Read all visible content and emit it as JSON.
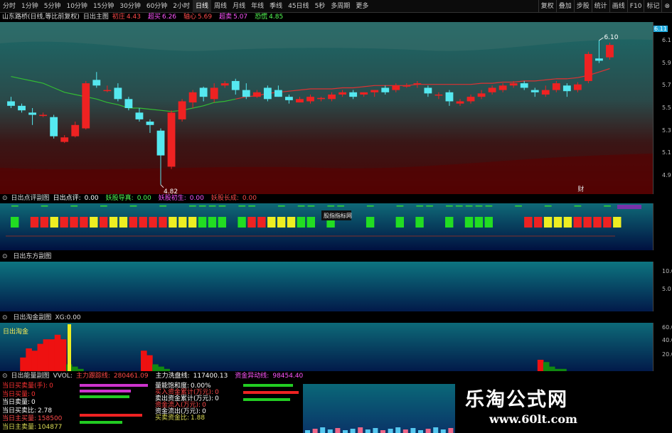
{
  "toolbar": {
    "items": [
      "分时",
      "1分钟",
      "5分钟",
      "10分钟",
      "15分钟",
      "30分钟",
      "60分钟",
      "2小时",
      "日线",
      "周线",
      "月线",
      "年线",
      "季线",
      "45日线",
      "5秒",
      "多周期",
      "更多"
    ],
    "active": "日线",
    "right": [
      "复权",
      "叠加",
      "步股",
      "统计",
      "画线",
      "F10",
      "标记"
    ]
  },
  "main_header": {
    "stock": "山东路桥(日线,等比前复权)",
    "indicator": "日出主图",
    "vals": [
      {
        "k": "初庄",
        "v": "4.43",
        "c": "#ff4a4a"
      },
      {
        "k": "超买",
        "v": "6.26",
        "c": "#ff55ff"
      },
      {
        "k": "轴心",
        "v": "5.69",
        "c": "#ff4a4a"
      },
      {
        "k": "超卖",
        "v": "5.07",
        "c": "#ff55ff"
      },
      {
        "k": "恐慌",
        "v": "4.85",
        "c": "#55ff55"
      }
    ]
  },
  "price": {
    "high_label": "6.10",
    "low_label": "4.82",
    "last": "6.11",
    "axis": [
      "6.1",
      "5.9",
      "5.7",
      "5.5",
      "5.3",
      "5.1",
      "4.9"
    ],
    "caption": "财"
  },
  "chart_data": {
    "type": "candlestick",
    "ylim": [
      4.8,
      6.2
    ],
    "x": [
      1,
      2,
      3,
      4,
      5,
      6,
      7,
      8,
      9,
      10,
      11,
      12,
      13,
      14,
      15,
      16,
      17,
      18,
      19,
      20,
      21,
      22,
      23,
      24,
      25,
      26,
      27,
      28,
      29,
      30,
      31,
      32,
      33,
      34,
      35,
      36,
      37,
      38,
      39,
      40,
      41,
      42,
      43,
      44,
      45,
      46,
      47,
      48,
      49,
      50,
      51,
      52,
      53,
      54,
      55,
      56,
      57,
      58,
      59
    ],
    "candles": [
      [
        5.56,
        5.52,
        5.6,
        5.5
      ],
      [
        5.52,
        5.48,
        5.54,
        5.46
      ],
      [
        5.46,
        5.44,
        5.5,
        5.35
      ],
      [
        5.43,
        5.44,
        5.46,
        5.42
      ],
      [
        5.42,
        5.25,
        5.44,
        5.23
      ],
      [
        5.2,
        5.24,
        5.26,
        5.19
      ],
      [
        5.25,
        5.35,
        5.38,
        5.24
      ],
      [
        5.32,
        5.72,
        5.74,
        5.31
      ],
      [
        5.75,
        5.7,
        5.82,
        5.68
      ],
      [
        5.66,
        5.66,
        5.7,
        5.64
      ],
      [
        5.68,
        5.58,
        5.72,
        5.56
      ],
      [
        5.58,
        5.5,
        5.6,
        5.48
      ],
      [
        5.46,
        5.4,
        5.5,
        5.38
      ],
      [
        5.38,
        5.35,
        5.4,
        5.28
      ],
      [
        5.3,
        5.08,
        5.32,
        4.82
      ],
      [
        4.98,
        5.46,
        5.48,
        4.96
      ],
      [
        5.4,
        5.56,
        5.58,
        5.38
      ],
      [
        5.55,
        5.64,
        5.66,
        5.5
      ],
      [
        5.68,
        5.6,
        5.69,
        5.56
      ],
      [
        5.58,
        5.68,
        5.72,
        5.55
      ],
      [
        5.7,
        5.72,
        5.74,
        5.68
      ],
      [
        5.74,
        5.66,
        5.76,
        5.62
      ],
      [
        5.66,
        5.6,
        5.72,
        5.58
      ],
      [
        5.6,
        5.64,
        5.66,
        5.59
      ],
      [
        5.68,
        5.58,
        5.7,
        5.56
      ],
      [
        5.66,
        5.6,
        5.7,
        5.6
      ],
      [
        5.6,
        5.57,
        5.62,
        5.54
      ],
      [
        5.55,
        5.58,
        5.6,
        5.55
      ],
      [
        5.56,
        5.6,
        5.62,
        5.54
      ],
      [
        5.58,
        5.59,
        5.6,
        5.56
      ],
      [
        5.58,
        5.62,
        5.64,
        5.56
      ],
      [
        5.62,
        5.64,
        5.66,
        5.6
      ],
      [
        5.64,
        5.6,
        5.66,
        5.58
      ],
      [
        5.62,
        5.64,
        5.64,
        5.6
      ],
      [
        5.64,
        5.66,
        5.66,
        5.6
      ],
      [
        5.68,
        5.64,
        5.7,
        5.62
      ],
      [
        5.66,
        5.7,
        5.72,
        5.64
      ],
      [
        5.7,
        5.7,
        5.72,
        5.68
      ],
      [
        5.72,
        5.72,
        5.74,
        5.68
      ],
      [
        5.68,
        5.63,
        5.7,
        5.6
      ],
      [
        5.62,
        5.62,
        5.64,
        5.58
      ],
      [
        5.64,
        5.56,
        5.66,
        5.52
      ],
      [
        5.54,
        5.56,
        5.58,
        5.52
      ],
      [
        5.56,
        5.6,
        5.62,
        5.54
      ],
      [
        5.6,
        5.63,
        5.66,
        5.58
      ],
      [
        5.64,
        5.68,
        5.7,
        5.62
      ],
      [
        5.66,
        5.7,
        5.72,
        5.64
      ],
      [
        5.7,
        5.72,
        5.74,
        5.68
      ],
      [
        5.72,
        5.68,
        5.74,
        5.66
      ],
      [
        5.66,
        5.64,
        5.68,
        5.6
      ],
      [
        5.62,
        5.66,
        5.7,
        5.6
      ],
      [
        5.66,
        5.72,
        5.74,
        5.64
      ],
      [
        5.7,
        5.65,
        5.72,
        5.6
      ],
      [
        5.66,
        5.71,
        5.73,
        5.64
      ],
      [
        5.74,
        5.98,
        6.0,
        5.72
      ],
      [
        5.94,
        5.92,
        6.1,
        5.9
      ],
      [
        5.95,
        6.06,
        6.08,
        5.93
      ]
    ],
    "ma": [
      5.78,
      5.76,
      5.74,
      5.72,
      5.68,
      5.64,
      5.62,
      5.6,
      5.58,
      5.55,
      5.53,
      5.5,
      5.5,
      5.49,
      5.48,
      5.47,
      5.48,
      5.5,
      5.52,
      5.55,
      5.56,
      5.58,
      5.6,
      5.61,
      5.63,
      5.64,
      5.65,
      5.66,
      5.67,
      5.67,
      5.67,
      5.68,
      5.68,
      5.69,
      5.7,
      5.7,
      5.7,
      5.7,
      5.71,
      5.71,
      5.71,
      5.71,
      5.71,
      5.71,
      5.72,
      5.72,
      5.73,
      5.73,
      5.74,
      5.74,
      5.75,
      5.76,
      5.76,
      5.77,
      5.79,
      5.82,
      5.85
    ]
  },
  "p2": {
    "title": "日出点评副图",
    "items": [
      {
        "k": "日出点评:",
        "v": "0.00",
        "c": "#ffffff"
      },
      {
        "k": "妖股导真:",
        "v": "0.00",
        "c": "#55ff55"
      },
      {
        "k": "妖股初生:",
        "v": "0.00",
        "c": "#ff55ff"
      },
      {
        "k": "妖股长成:",
        "v": "0.00",
        "c": "#ff4a4a"
      }
    ],
    "tooltip": "股指指标网",
    "squares": "G.RRYRRRYRYYRRRRYYYGGG.GRRYYYGG.G...G..G.G..G.GGG...RRYYYRRRRY"
  },
  "p3": {
    "title": "日出东方副图",
    "axis": [
      "10.0",
      "5.0"
    ]
  },
  "p4": {
    "title": "日出淘金副图",
    "xg": "XG:0.00",
    "caption": "日出淘金",
    "axis": [
      "60.0",
      "40.0",
      "20.0"
    ],
    "bars": [
      0,
      0,
      0,
      6,
      10,
      9,
      12,
      14,
      14,
      16,
      14,
      3,
      2,
      1,
      0,
      0,
      0,
      0,
      0,
      0,
      0,
      0,
      0,
      0,
      9,
      7,
      3,
      2,
      1,
      0,
      0,
      0,
      0,
      0,
      0,
      0,
      0,
      0,
      0,
      0,
      0,
      0,
      0,
      0,
      0,
      0,
      0,
      0,
      0,
      0,
      0,
      0,
      0,
      0,
      0,
      0,
      0,
      0,
      0,
      0,
      0,
      0,
      0,
      0,
      0,
      0,
      0,
      0,
      0,
      0,
      0,
      0,
      0,
      0,
      0,
      0,
      0,
      0,
      0,
      0,
      0,
      0,
      0,
      0,
      0,
      0,
      0,
      0,
      0,
      0,
      0,
      0,
      0,
      5,
      4,
      2,
      1,
      1,
      0,
      0,
      0,
      0,
      0,
      0,
      0,
      0,
      0
    ]
  },
  "p5": {
    "title": "日出能量副图",
    "vol": "VVOL:",
    "items": [
      {
        "k": "主力跟踪线:",
        "v": "280461.09",
        "c": "#ff4a4a"
      },
      {
        "k": "主力洗盘线:",
        "v": "117400.13",
        "c": "#ffffff"
      },
      {
        "k": "资金异动线:",
        "v": "98454.40",
        "c": "#ff55ff"
      }
    ],
    "left": [
      {
        "k": "当日买卖量(手):",
        "v": "0",
        "c": "#ff3333"
      },
      {
        "k": "当日买量:",
        "v": "0",
        "c": "#ff3333"
      },
      {
        "k": "当日卖量:",
        "v": "0",
        "c": "#ffffff"
      },
      {
        "k": "当日买卖比:",
        "v": "2.78",
        "c": "#ffffff"
      },
      {
        "k": "当日主买量:",
        "v": "158500",
        "c": "#ff4a4a"
      },
      {
        "k": "当日主卖量:",
        "v": "104877",
        "c": "#dddd55"
      }
    ],
    "mid": [
      {
        "k": "量能饱和度:",
        "v": "0.00%",
        "c": "#ffffff"
      },
      {
        "k": "买入资金累计(万元):",
        "v": "0",
        "c": "#ff4a4a"
      },
      {
        "k": "卖出资金累计(万元):",
        "v": "0",
        "c": "#ffffff"
      },
      {
        "k": "资金流入(万元):",
        "v": "0",
        "c": "#ff4a4a"
      },
      {
        "k": "资金流出(万元):",
        "v": "0",
        "c": "#ffffff"
      },
      {
        "k": "买卖资金比:",
        "v": "1.88",
        "c": "#dddd55"
      }
    ]
  },
  "watermark": {
    "title": "乐淘公式网",
    "url": "www.60lt.com"
  },
  "colors": {
    "up": "#ee2222",
    "down": "#55e8f0",
    "ma_long": "#33bb33",
    "ma_short": "#dd3333",
    "green": "#22dd22",
    "red": "#ee2222",
    "yellow": "#eeee22"
  }
}
